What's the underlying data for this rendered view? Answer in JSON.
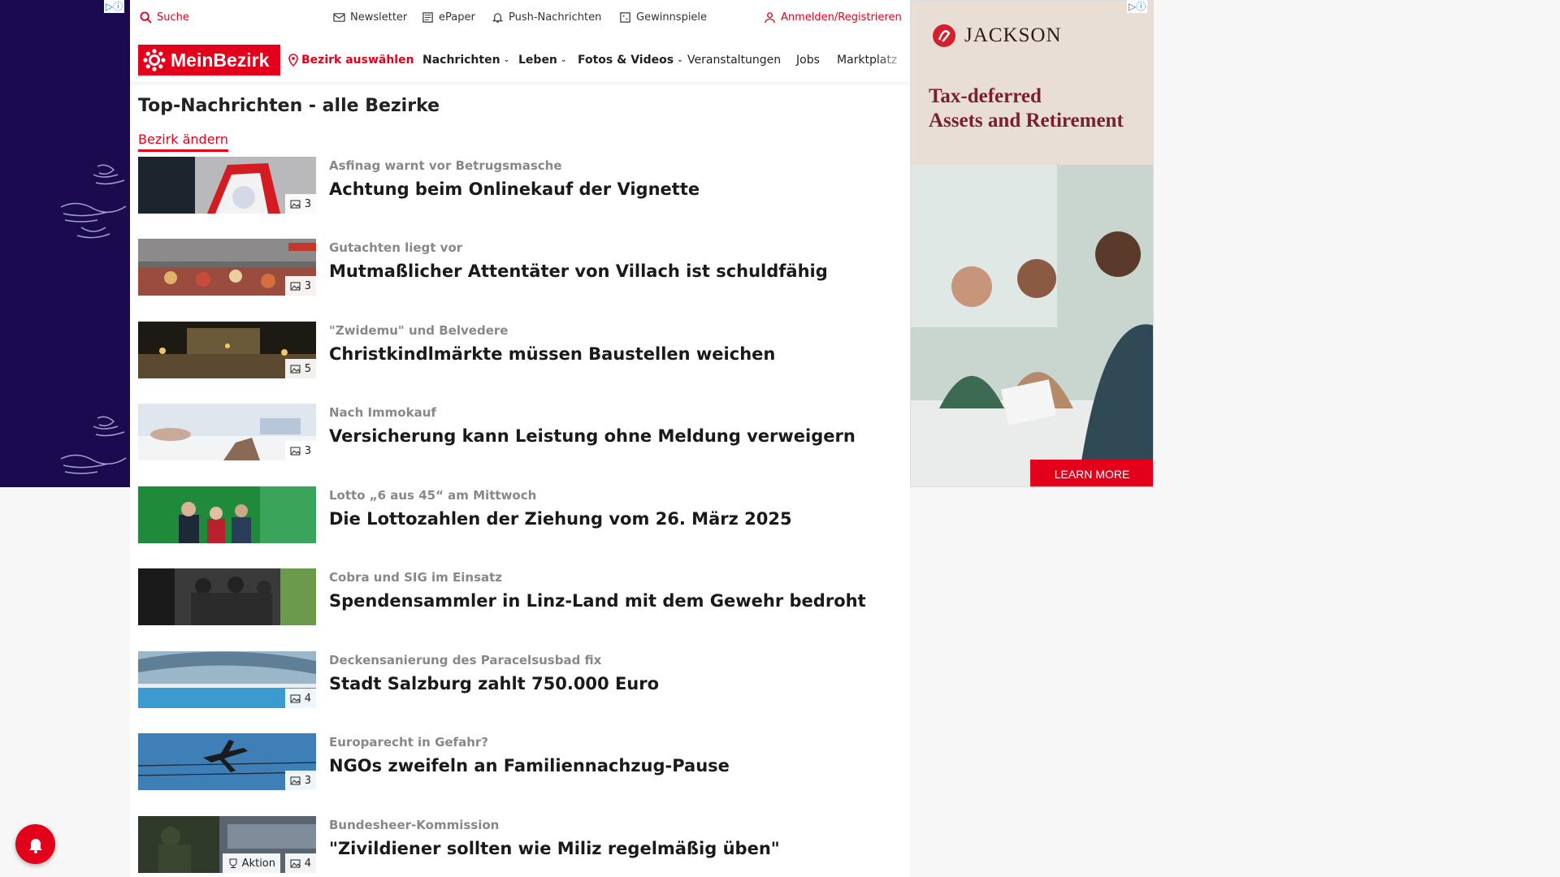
{
  "topbar": {
    "search": "Suche",
    "newsletter": "Newsletter",
    "epaper": "ePaper",
    "push": "Push-Nachrichten",
    "games": "Gewinnspiele",
    "login": "Anmelden/Registrieren"
  },
  "nav": {
    "logo": "MeinBezirk",
    "district": "Bezirk auswählen",
    "items": [
      "Nachrichten",
      "Leben",
      "Fotos & Videos",
      "Veranstaltungen",
      "Jobs",
      "Marktplatz"
    ]
  },
  "page": {
    "title": "Top-Nachrichten - alle Bezirke",
    "change_district": "Bezirk ändern"
  },
  "articles": [
    {
      "kicker": "Asfinag warnt vor Betrugsmasche",
      "headline": "Achtung beim Onlinekauf der Vignette",
      "images": "3"
    },
    {
      "kicker": "Gutachten liegt vor",
      "headline": "Mutmaßlicher Attentäter von Villach ist schuldfähig",
      "images": "3"
    },
    {
      "kicker": "\"Zwidemu\" und Belvedere",
      "headline": "Christkindlmärkte müssen Baustellen weichen",
      "images": "5"
    },
    {
      "kicker": "Nach Immokauf",
      "headline": "Versicherung kann Leistung ohne Meldung verweigern",
      "images": "3"
    },
    {
      "kicker": "Lotto „6 aus 45“ am Mittwoch",
      "headline": "Die Lottozahlen der Ziehung vom 26. März 2025",
      "images": ""
    },
    {
      "kicker": "Cobra und SIG im Einsatz",
      "headline": "Spendensammler in Linz-Land mit dem Gewehr bedroht",
      "images": ""
    },
    {
      "kicker": "Deckensanierung des Paracelsusbad fix",
      "headline": "Stadt Salzburg zahlt 750.000 Euro",
      "images": "4"
    },
    {
      "kicker": "Europarecht in Gefahr?",
      "headline": "NGOs zweifeln an Familiennachzug-Pause",
      "images": "3"
    },
    {
      "kicker": "Bundesheer-Kommission",
      "headline": "\"Zivildiener sollten wie Miliz regelmäßig üben\"",
      "images": "4",
      "action": "Aktion"
    }
  ],
  "ad": {
    "brand": "JACKSON",
    "line1": "Tax-deferred",
    "line2": "Assets and Retirement",
    "cta": "LEARN MORE"
  },
  "colors": {
    "brand_red": "#e2001a",
    "left_skin": "#1c0a4f"
  }
}
